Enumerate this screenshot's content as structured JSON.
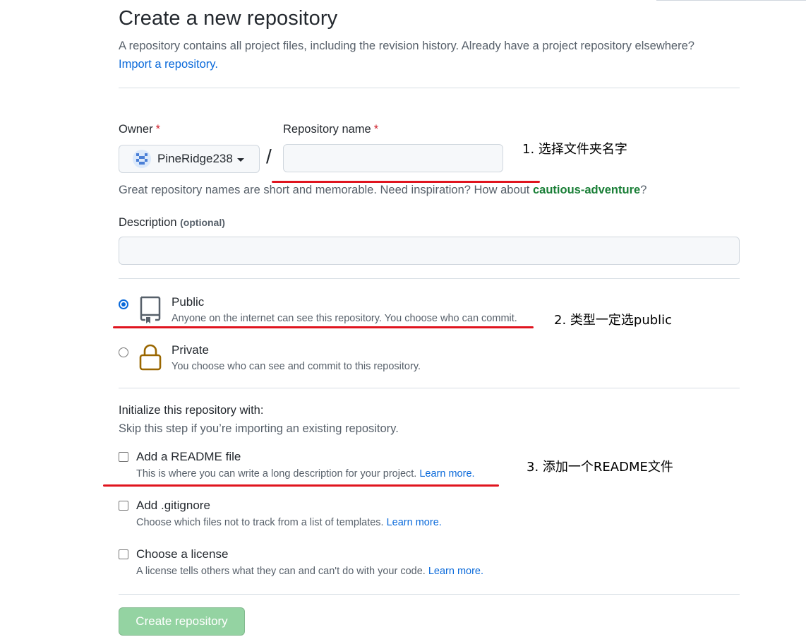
{
  "header": {
    "title": "Create a new repository",
    "subtitle": "A repository contains all project files, including the revision history. Already have a project repository elsewhere?",
    "import_link": "Import a repository."
  },
  "owner": {
    "label": "Owner",
    "required_mark": "*",
    "value": "PineRidge238"
  },
  "slash": "/",
  "repo_name": {
    "label": "Repository name",
    "required_mark": "*",
    "value": ""
  },
  "hint": {
    "text": "Great repository names are short and memorable. Need inspiration? How about",
    "suggestion": "cautious-adventure",
    "suffix": "?"
  },
  "description": {
    "label": "Description",
    "optional": "(optional)",
    "value": ""
  },
  "visibility": {
    "public": {
      "title": "Public",
      "desc": "Anyone on the internet can see this repository. You choose who can commit.",
      "checked": true
    },
    "private": {
      "title": "Private",
      "desc": "You choose who can see and commit to this repository.",
      "checked": false
    }
  },
  "init": {
    "heading": "Initialize this repository with:",
    "sub": "Skip this step if you’re importing an existing repository.",
    "readme": {
      "title": "Add a README file",
      "desc": "This is where you can write a long description for your project.",
      "link": "Learn more."
    },
    "gitignore": {
      "title": "Add .gitignore",
      "desc": "Choose which files not to track from a list of templates.",
      "link": "Learn more."
    },
    "license": {
      "title": "Choose a license",
      "desc": "A license tells others what they can and can't do with your code.",
      "link": "Learn more."
    }
  },
  "create_button": "Create repository",
  "annotations": {
    "step1": "1. 选择文件夹名字",
    "step2": "2. 类型一定选public",
    "step3": "3. 添加一个README文件"
  },
  "colors": {
    "link": "#0969da",
    "suggestion": "#1a7f37",
    "required": "#cf222e",
    "button_disabled": "#94d3a2",
    "annotation_line": "#e0141e",
    "lock_icon": "#9a6700"
  }
}
